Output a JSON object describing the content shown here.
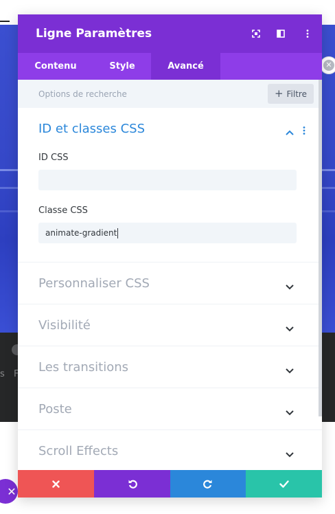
{
  "modal": {
    "title": "Ligne Paramètres",
    "header_icons": [
      "fullscreen-icon",
      "columns-icon",
      "more-vertical-icon"
    ]
  },
  "tabs": [
    {
      "label": "Contenu",
      "active": false
    },
    {
      "label": "Style",
      "active": false
    },
    {
      "label": "Avancé",
      "active": true
    }
  ],
  "search": {
    "placeholder": "Options de recherche",
    "filter_label": "Filtre"
  },
  "open_section": {
    "title": "ID et classes CSS",
    "fields": [
      {
        "label": "ID CSS",
        "value": ""
      },
      {
        "label": "Classe CSS",
        "value": "animate-gradient"
      }
    ]
  },
  "sections": [
    {
      "title": "Personnaliser CSS"
    },
    {
      "title": "Visibilité"
    },
    {
      "title": "Les transitions"
    },
    {
      "title": "Poste"
    },
    {
      "title": "Scroll Effects"
    }
  ],
  "background": {
    "text_fragments": [
      "s",
      "F"
    ]
  },
  "footer": {
    "buttons": [
      "cancel-icon",
      "undo-icon",
      "redo-icon",
      "save-icon"
    ]
  },
  "colors": {
    "header_purple": "#7b2fd4",
    "tab_purple": "#8e3de8",
    "accent_blue": "#2b87da",
    "cancel_red": "#ef5555",
    "save_green": "#29c4a9"
  }
}
